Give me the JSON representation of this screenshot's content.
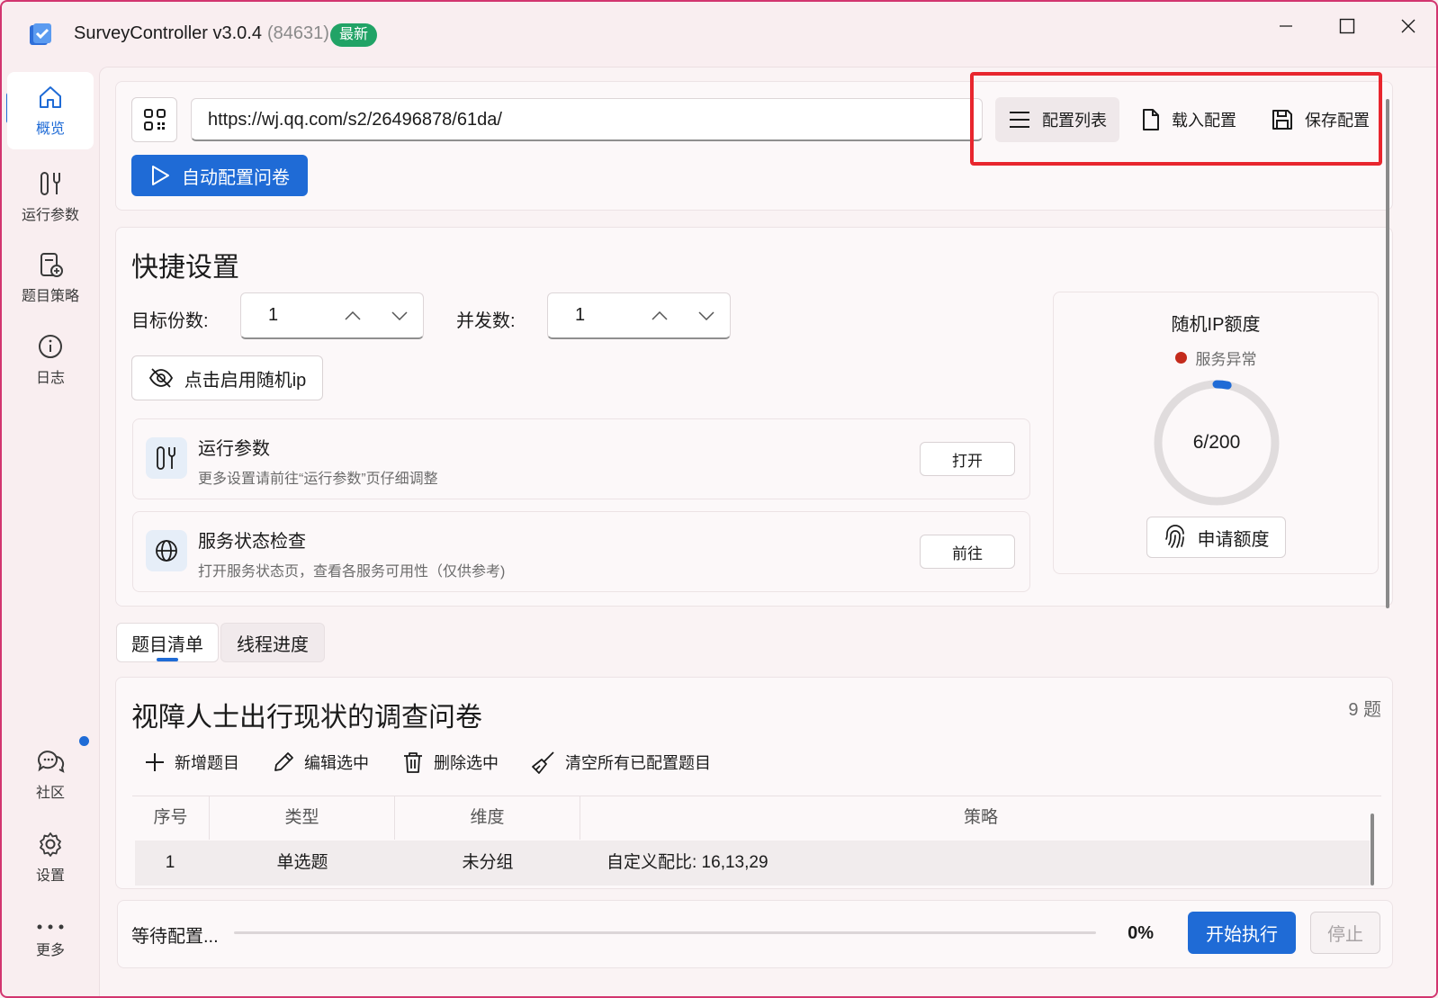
{
  "app": {
    "title": "SurveyController v3.0.4",
    "build": "(84631)",
    "badge": "最新"
  },
  "sidebar": {
    "items": [
      {
        "label": "概览",
        "icon": "home-icon"
      },
      {
        "label": "运行参数",
        "icon": "tools-icon"
      },
      {
        "label": "题目策略",
        "icon": "strategy-icon"
      },
      {
        "label": "日志",
        "icon": "info-icon"
      },
      {
        "label": "社区",
        "icon": "chat-icon"
      },
      {
        "label": "设置",
        "icon": "gear-icon"
      },
      {
        "label": "更多",
        "icon": "more-icon"
      }
    ]
  },
  "config": {
    "url": "https://wj.qq.com/s2/26496878/61da/",
    "auto_config_label": "自动配置问卷",
    "list_label": "配置列表",
    "load_label": "载入配置",
    "save_label": "保存配置"
  },
  "quick": {
    "title": "快捷设置",
    "target_label": "目标份数:",
    "target_value": "1",
    "concurrency_label": "并发数:",
    "concurrency_value": "1",
    "random_ip_label": "点击启用随机ip",
    "rows": [
      {
        "title": "运行参数",
        "desc": "更多设置请前往“运行参数”页仔细调整",
        "button": "打开"
      },
      {
        "title": "服务状态检查",
        "desc": "打开服务状态页，查看各服务可用性（仅供参考)",
        "button": "前往"
      }
    ]
  },
  "ip_quota": {
    "title": "随机IP额度",
    "status": "服务异常",
    "status_color": "#c42b1c",
    "used": 6,
    "total": 200,
    "display": "6/200",
    "apply_label": "申请额度"
  },
  "tabs": [
    {
      "label": "题目清单"
    },
    {
      "label": "线程进度"
    }
  ],
  "questionnaire": {
    "title": "视障人士出行现状的调查问卷",
    "count": "9 题",
    "actions": {
      "add": "新增题目",
      "edit": "编辑选中",
      "delete": "删除选中",
      "clear": "清空所有已配置题目"
    },
    "columns": [
      "序号",
      "类型",
      "维度",
      "策略"
    ],
    "rows": [
      {
        "index": "1",
        "type": "单选题",
        "dimension": "未分组",
        "strategy": "自定义配比: 16,13,29"
      }
    ]
  },
  "footer": {
    "status": "等待配置...",
    "progress": "0%",
    "progress_value": 0,
    "start_label": "开始执行",
    "stop_label": "停止"
  },
  "colors": {
    "accent": "#1f6bd6",
    "badge_green": "#21a366",
    "highlight_red": "#e8262e"
  }
}
